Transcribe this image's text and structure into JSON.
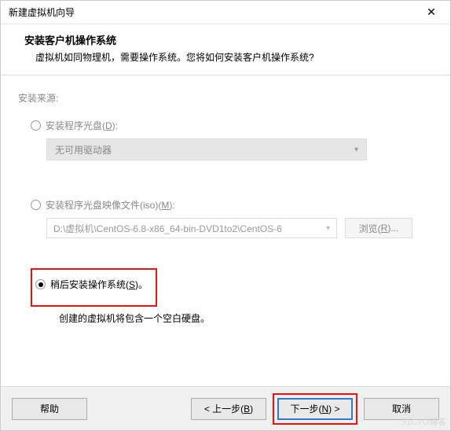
{
  "titlebar": {
    "title": "新建虚拟机向导"
  },
  "header": {
    "title": "安装客户机操作系统",
    "subtitle": "虚拟机如同物理机，需要操作系统。您将如何安装客户机操作系统?"
  },
  "source": {
    "label": "安装来源:",
    "opt1": {
      "pre": "安装程序光盘(",
      "hot": "D",
      "post": "):"
    },
    "combo1": "无可用驱动器",
    "opt2": {
      "pre": "安装程序光盘映像文件(iso)(",
      "hot": "M",
      "post": "):"
    },
    "iso_path": "D:\\虚拟机\\CentOS-6.8-x86_64-bin-DVD1to2\\CentOS-6",
    "browse": {
      "pre": "浏览(",
      "hot": "R",
      "post": ")..."
    },
    "opt3": {
      "pre": "稍后安装操作系统(",
      "hot": "S",
      "post": ")。"
    },
    "opt3_help": "创建的虚拟机将包含一个空白硬盘。"
  },
  "footer": {
    "help": "帮助",
    "back": {
      "pre": "< 上一步(",
      "hot": "B",
      "post": ")"
    },
    "next": {
      "pre": "下一步(",
      "hot": "N",
      "post": ") >"
    },
    "cancel": "取消"
  },
  "watermark": "51CTO博客"
}
